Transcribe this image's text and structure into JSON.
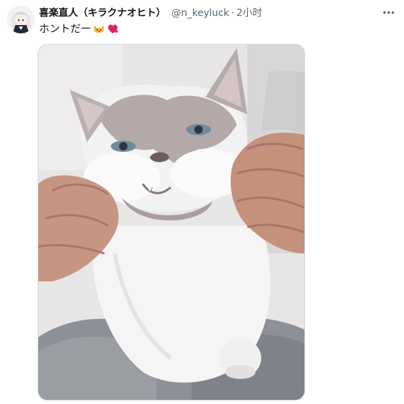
{
  "tweet": {
    "author": {
      "display_name": "喜楽直人（キラクナオヒト）",
      "handle": "@n_keyluck",
      "avatar_icon": "anime-avatar-icon"
    },
    "separator": "·",
    "time": "2小时",
    "more_icon": "more-dots-icon",
    "text": "ホントだー",
    "emojis": [
      "cat-face-emoji",
      "heart-emoji"
    ],
    "media_icon": "photo-cat-icon"
  },
  "colors": {
    "text_primary": "#0f1419",
    "text_secondary": "#536471",
    "border": "#cfd9de",
    "heart": "#e0245e"
  }
}
